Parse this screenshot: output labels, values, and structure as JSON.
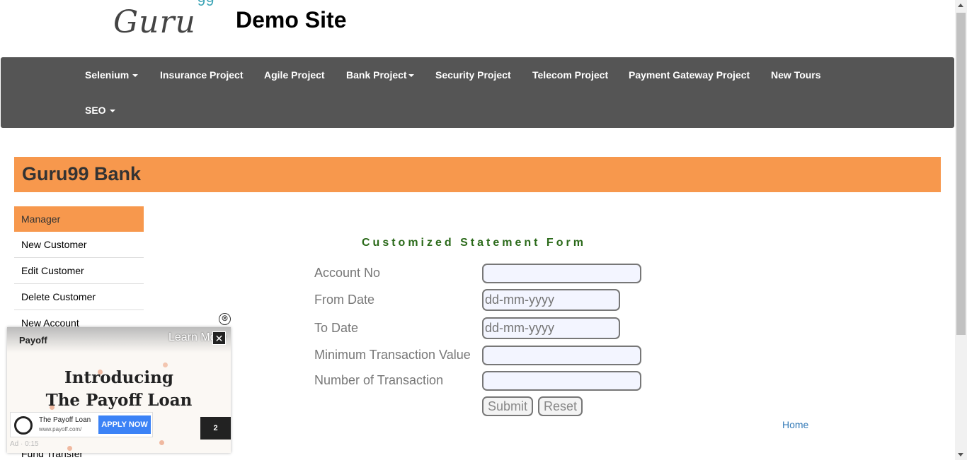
{
  "header": {
    "logo_text": "Guru",
    "logo_sup": "99",
    "site_title": "Demo Site"
  },
  "nav": {
    "items": [
      {
        "label": "Selenium",
        "dropdown": true
      },
      {
        "label": "Insurance Project",
        "dropdown": false
      },
      {
        "label": "Agile Project",
        "dropdown": false
      },
      {
        "label": "Bank Project",
        "dropdown": true
      },
      {
        "label": "Security Project",
        "dropdown": false
      },
      {
        "label": "Telecom Project",
        "dropdown": false
      },
      {
        "label": "Payment Gateway Project",
        "dropdown": false
      },
      {
        "label": "New Tours",
        "dropdown": false
      },
      {
        "label": "SEO",
        "dropdown": true
      }
    ]
  },
  "banner": {
    "title": "Guru99 Bank"
  },
  "sidebar": {
    "items": [
      {
        "label": "Manager"
      },
      {
        "label": "New Customer"
      },
      {
        "label": "Edit Customer"
      },
      {
        "label": "Delete Customer"
      },
      {
        "label": "New Account"
      }
    ],
    "last_item": "Fund Transfer"
  },
  "form": {
    "title": "Customized Statement Form",
    "fields": [
      {
        "label": "Account No",
        "value": "",
        "placeholder": ""
      },
      {
        "label": "From Date",
        "value": "",
        "placeholder": "dd-mm-yyyy"
      },
      {
        "label": "To Date",
        "value": "",
        "placeholder": "dd-mm-yyyy"
      },
      {
        "label": "Minimum Transaction Value",
        "value": "",
        "placeholder": ""
      },
      {
        "label": "Number of Transaction",
        "value": "",
        "placeholder": ""
      }
    ],
    "submit_label": "Submit",
    "reset_label": "Reset",
    "home_link": "Home"
  },
  "ad": {
    "close_outer": "⊗",
    "brand": "Payoff",
    "learn_more": "Learn More",
    "close": "✕",
    "headline_1": "Introducing",
    "headline_2": "The Payoff Loan",
    "card_name": "The Payoff Loan",
    "card_url": "www.payoff.com/",
    "apply_label": "APPLY NOW",
    "countdown": "2",
    "footer": "Ad · 0:15"
  },
  "colors": {
    "nav_bg": "#555555",
    "accent_orange": "#f7984d",
    "form_title_green": "#2b6a1a",
    "link_blue": "#337ab7"
  }
}
